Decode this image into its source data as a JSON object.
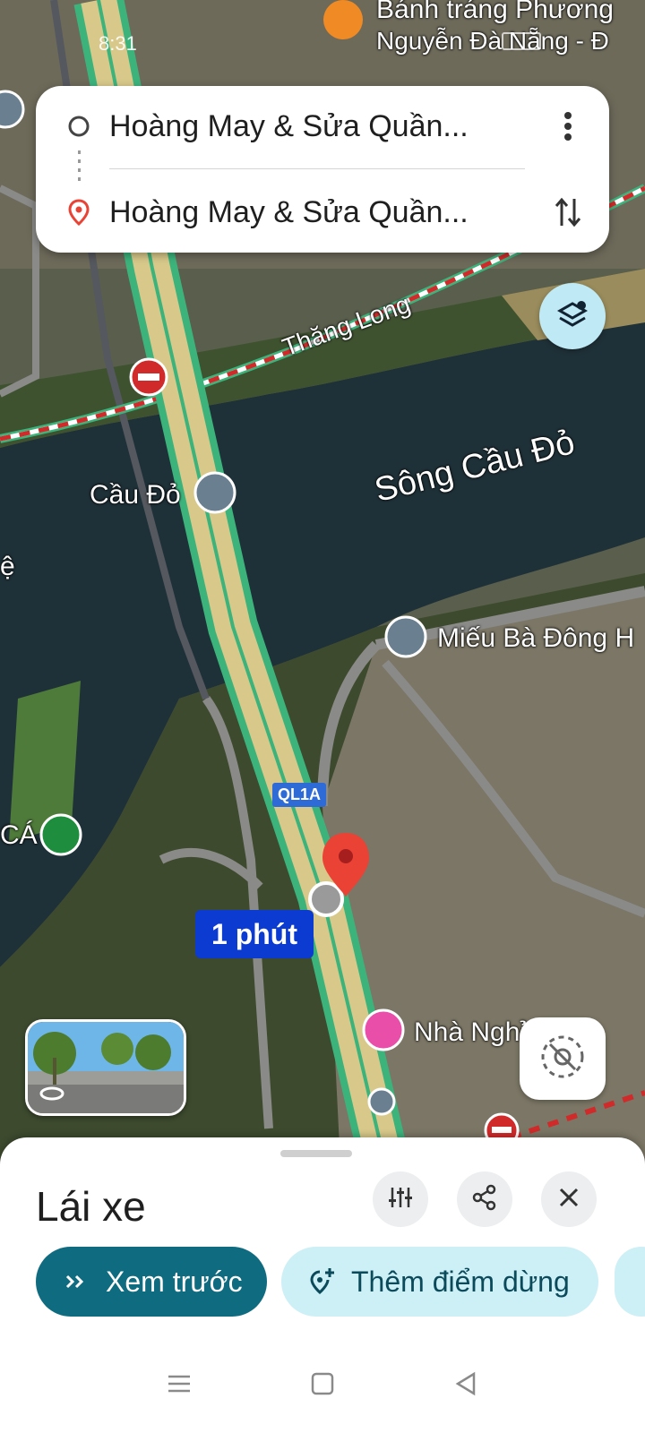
{
  "status": {
    "time": "8:31"
  },
  "route": {
    "origin": "Hoàng May & Sửa Quần...",
    "destination": "Hoàng May & Sửa Quần..."
  },
  "map": {
    "labels": {
      "top_place": "Bánh tráng Phương",
      "top_place_sub": "Nguyễn Đà Nẵng - Đ",
      "road_thang_long": "Thăng Long",
      "river": "Sông Cầu Đỏ",
      "bridge": "Cầu Đỏ",
      "temple": "Miếu Bà Đông H",
      "guesthouse": "Nhà Nghỉ ... P",
      "left_edge": "CÁ",
      "left_edge2": "ệ",
      "shield": "QL1A"
    },
    "eta": "1 phút"
  },
  "sheet": {
    "title": "Lái xe",
    "preview_label": "Xem trước",
    "add_stop_label": "Thêm điểm dừng"
  },
  "colors": {
    "accent": "#0f6b7f",
    "route": "#0b3bd0",
    "pin": "#ea4335"
  }
}
